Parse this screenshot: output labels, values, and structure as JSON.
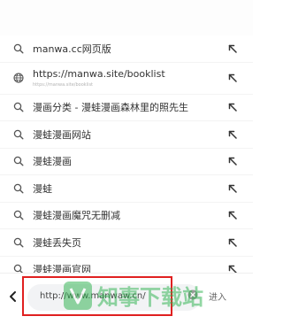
{
  "suggestions": [
    {
      "text": "manwa.cc网页版",
      "subtext": "",
      "lead_icon": "search-icon",
      "fill_icon": "arrow-up-left-icon"
    },
    {
      "text": "https://manwa.site/booklist",
      "subtext": "https://manwa.site/booklist",
      "lead_icon": "globe-icon",
      "fill_icon": "arrow-up-left-icon"
    },
    {
      "text": "漫画分类 - 漫蛙漫画森林里的照先生",
      "subtext": "",
      "lead_icon": "search-icon",
      "fill_icon": "arrow-up-left-icon"
    },
    {
      "text": "漫蛙漫画网站",
      "subtext": "",
      "lead_icon": "search-icon",
      "fill_icon": "arrow-up-left-icon"
    },
    {
      "text": "漫蛙漫画",
      "subtext": "",
      "lead_icon": "search-icon",
      "fill_icon": "arrow-up-left-icon"
    },
    {
      "text": "漫蛙",
      "subtext": "",
      "lead_icon": "search-icon",
      "fill_icon": "arrow-up-left-icon"
    },
    {
      "text": "漫蛙漫画魔咒无删减",
      "subtext": "",
      "lead_icon": "search-icon",
      "fill_icon": "arrow-up-left-icon"
    },
    {
      "text": "漫蛙丢失页",
      "subtext": "",
      "lead_icon": "search-icon",
      "fill_icon": "arrow-up-left-icon"
    },
    {
      "text": "漫蛙漫画官网",
      "subtext": "",
      "lead_icon": "search-icon",
      "fill_icon": "arrow-up-left-icon"
    }
  ],
  "address_bar": {
    "value": "http://www.manwaw.cn/",
    "enter_label": "进入",
    "back_icon": "chevron-left-icon",
    "clear_icon": "close-circle-icon"
  },
  "watermark": {
    "text": "知事下载站",
    "icon": "watermark-logo-icon"
  },
  "colors": {
    "highlight_border": "#e02020",
    "watermark_green": "#2bb24c",
    "icon_gray": "#555555"
  }
}
